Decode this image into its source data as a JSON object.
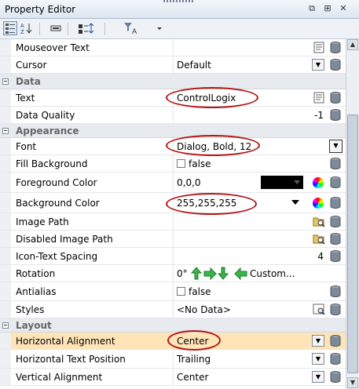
{
  "window": {
    "title": "Property Editor",
    "controls": {
      "restore": "⧉",
      "pin": "⊞",
      "close": "✕"
    }
  },
  "toolbar": {
    "icons": [
      "categorized-view-icon",
      "alphabetical-sort-icon",
      "dynamic-properties-icon",
      "binding-icon",
      "style-filter-icon",
      "dropdown-arrow-icon"
    ]
  },
  "properties": {
    "mouseover_text": {
      "name": "Mouseover Text",
      "value": ""
    },
    "cursor": {
      "name": "Cursor",
      "value": "Default"
    },
    "cat_data": {
      "label": "Data"
    },
    "text": {
      "name": "Text",
      "value": "ControlLogix"
    },
    "data_quality": {
      "name": "Data Quality",
      "value": "-1"
    },
    "cat_appearance": {
      "label": "Appearance"
    },
    "font": {
      "name": "Font",
      "value": "Dialog, Bold, 12"
    },
    "fill_background": {
      "name": "Fill Background",
      "value": "false"
    },
    "foreground_color": {
      "name": "Foreground Color",
      "value": "0,0,0",
      "swatch": "#000000"
    },
    "background_color": {
      "name": "Background Color",
      "value": "255,255,255"
    },
    "image_path": {
      "name": "Image Path",
      "value": ""
    },
    "disabled_image_path": {
      "name": "Disabled Image Path",
      "value": ""
    },
    "icon_text_spacing": {
      "name": "Icon-Text Spacing",
      "value": "4"
    },
    "rotation": {
      "name": "Rotation",
      "value": "0°",
      "custom": "Custom..."
    },
    "antialias": {
      "name": "Antialias",
      "value": "false"
    },
    "styles": {
      "name": "Styles",
      "value": "<No Data>"
    },
    "cat_layout": {
      "label": "Layout"
    },
    "horizontal_alignment": {
      "name": "Horizontal Alignment",
      "value": "Center"
    },
    "horizontal_text_position": {
      "name": "Horizontal Text Position",
      "value": "Trailing"
    },
    "vertical_alignment": {
      "name": "Vertical Alignment",
      "value": "Center"
    }
  },
  "colors": {
    "highlight_row": "#ffe4b8",
    "annotation_oval": "#b31414",
    "category_bg": "#e7eaee"
  }
}
